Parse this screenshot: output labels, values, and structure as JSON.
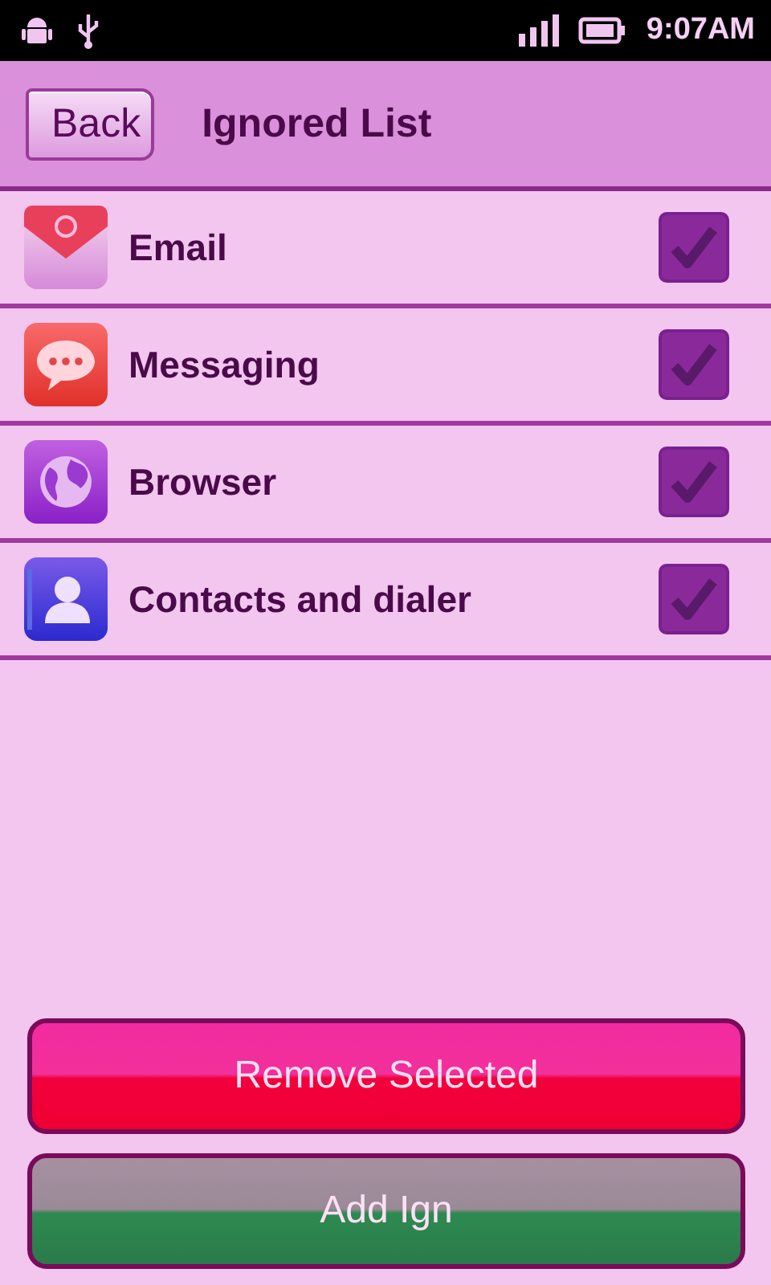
{
  "status_bar": {
    "time": "9:07AM"
  },
  "header": {
    "back": "Back",
    "title": "Ignored List"
  },
  "apps": [
    {
      "name": "Email",
      "kind": "email",
      "checked": true
    },
    {
      "name": "Messaging",
      "kind": "messaging",
      "checked": true
    },
    {
      "name": "Browser",
      "kind": "browser",
      "checked": true
    },
    {
      "name": "Contacts and dialer",
      "kind": "contacts",
      "checked": true
    }
  ],
  "buttons": [
    {
      "label": "Remove Selected",
      "kind": "remove"
    },
    {
      "label": "Add Ign",
      "kind": "add"
    }
  ]
}
